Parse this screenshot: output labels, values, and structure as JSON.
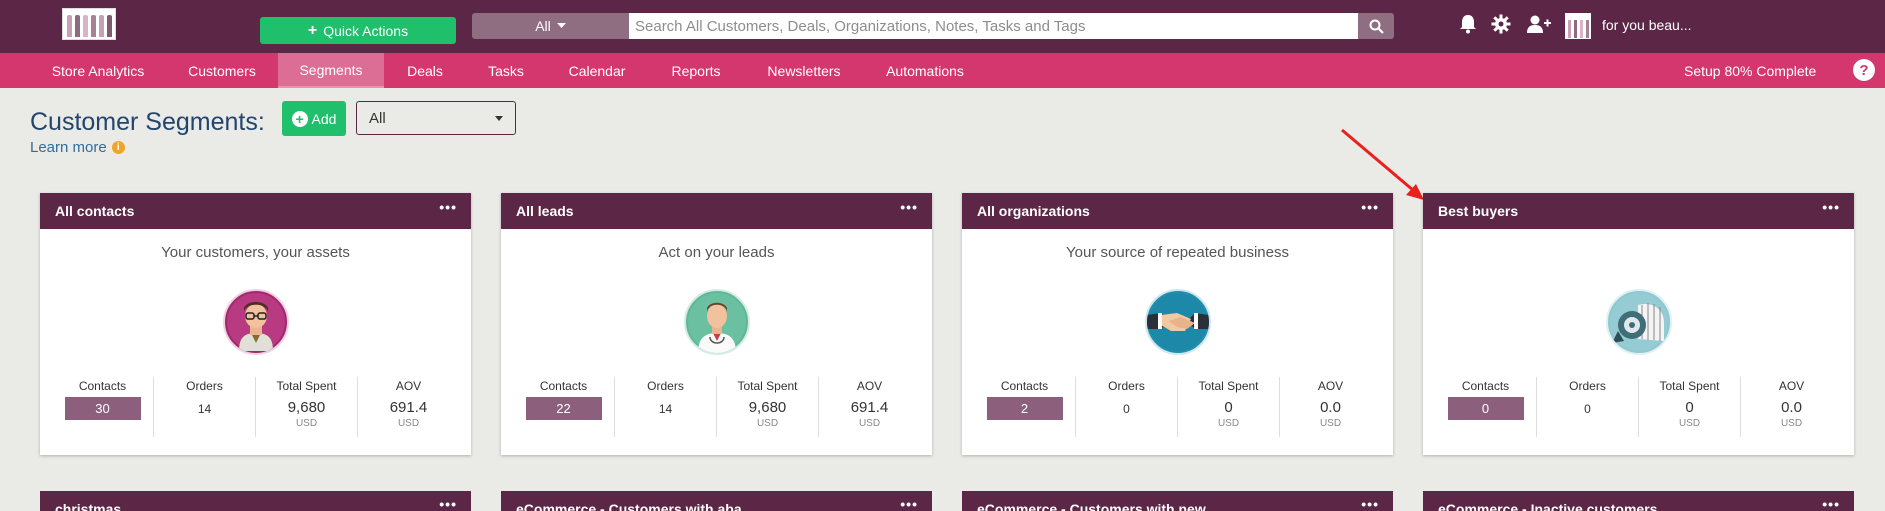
{
  "header": {
    "quick_actions_label": "Quick Actions",
    "search_scope": "All",
    "search_placeholder": "Search All Customers, Deals, Organizations, Notes, Tasks and Tags",
    "username": "for you beau..."
  },
  "nav": {
    "items": [
      {
        "label": "Store Analytics"
      },
      {
        "label": "Customers"
      },
      {
        "label": "Segments",
        "active": true
      },
      {
        "label": "Deals"
      },
      {
        "label": "Tasks"
      },
      {
        "label": "Calendar"
      },
      {
        "label": "Reports"
      },
      {
        "label": "Newsletters"
      },
      {
        "label": "Automations"
      }
    ],
    "setup_label": "Setup 80% Complete",
    "help_label": "?"
  },
  "page": {
    "title": "Customer Segments:",
    "add_label": "Add",
    "filter_value": "All",
    "learn_more": "Learn more",
    "info_label": "i"
  },
  "stat_labels": {
    "contacts": "Contacts",
    "orders": "Orders",
    "total_spent": "Total Spent",
    "aov": "AOV",
    "currency": "USD"
  },
  "cards": [
    {
      "title": "All contacts",
      "subtitle": "Your customers, your assets",
      "contacts": "30",
      "orders": "14",
      "total_spent": "9,680",
      "aov": "691.4"
    },
    {
      "title": "All leads",
      "subtitle": "Act on your leads",
      "contacts": "22",
      "orders": "14",
      "total_spent": "9,680",
      "aov": "691.4"
    },
    {
      "title": "All organizations",
      "subtitle": "Your source of repeated business",
      "contacts": "2",
      "orders": "0",
      "total_spent": "0",
      "aov": "0.0"
    },
    {
      "title": "Best buyers",
      "subtitle": "",
      "contacts": "0",
      "orders": "0",
      "total_spent": "0",
      "aov": "0.0"
    }
  ],
  "cards_row2": [
    {
      "title": "christmas"
    },
    {
      "title": "eCommerce - Customers with aba..."
    },
    {
      "title": "eCommerce - Customers with new..."
    },
    {
      "title": "eCommerce - Inactive customers"
    }
  ],
  "menu_glyph": "•••",
  "colors": {
    "topbar": "#5c2746",
    "navbar": "#d3376e",
    "accent_green": "#1fbf6c",
    "title_blue": "#21456d"
  }
}
